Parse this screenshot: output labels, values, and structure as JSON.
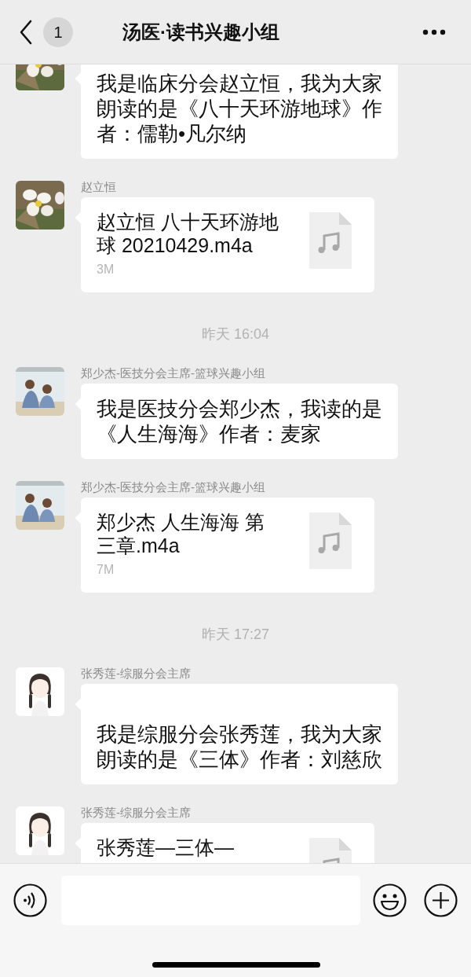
{
  "header": {
    "back_badge": "1",
    "title": "汤医·读书兴趣小组"
  },
  "messages": [
    {
      "kind": "text",
      "blank_line_above": false,
      "text": "我是临床分会赵立恒，我为大家朗读的是《八十天环游地球》作者：儒勒•凡尔纳"
    },
    {
      "kind": "file",
      "sender": "赵立恒",
      "file_name": "赵立恒 八十天环游地球 20210429.m4a",
      "size": "3M"
    },
    {
      "kind": "time",
      "text": "昨天 16:04"
    },
    {
      "kind": "text",
      "blank_line_above": false,
      "sender": "郑少杰-医技分会主席-篮球兴趣小组",
      "text": "我是医技分会郑少杰，我读的是《人生海海》作者：麦家"
    },
    {
      "kind": "file",
      "sender": "郑少杰-医技分会主席-篮球兴趣小组",
      "file_name": "郑少杰 人生海海 第三章.m4a",
      "size": "7M"
    },
    {
      "kind": "time",
      "text": "昨天 17:27"
    },
    {
      "kind": "text",
      "blank_line_above": true,
      "sender": "张秀莲-综服分会主席",
      "text": "我是综服分会张秀莲，我为大家朗读的是《三体》作者：刘慈欣"
    },
    {
      "kind": "file",
      "sender": "张秀莲-综服分会主席",
      "file_name": "张秀莲—三体—"
    }
  ]
}
